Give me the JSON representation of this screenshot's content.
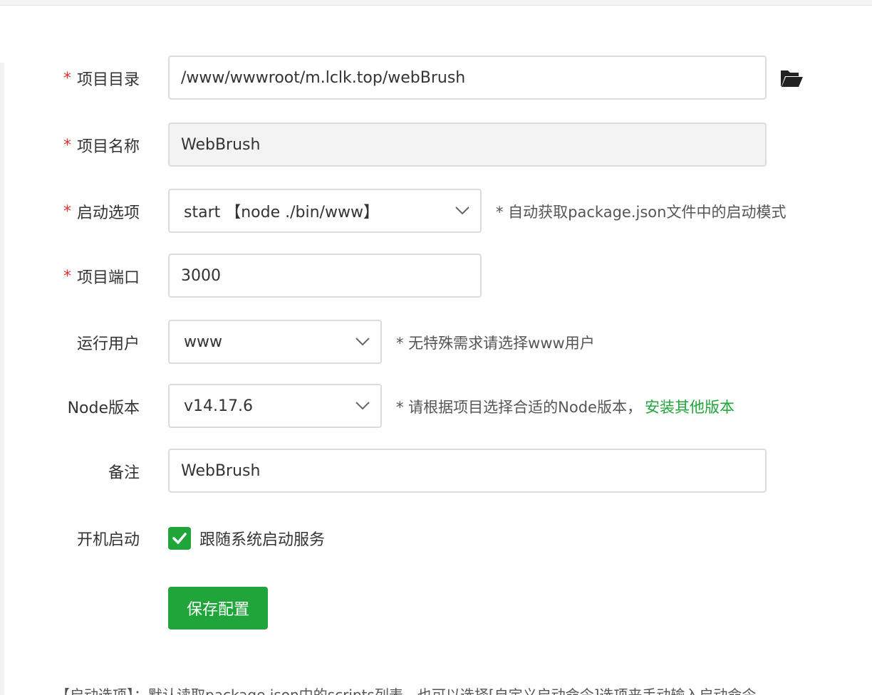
{
  "form": {
    "project_dir": {
      "label": "项目目录",
      "required_mark": "*",
      "value": "/www/wwwroot/m.lclk.top/webBrush"
    },
    "project_name": {
      "label": "项目名称",
      "required_mark": "*",
      "value": "WebBrush"
    },
    "start_option": {
      "label": "启动选项",
      "required_mark": "*",
      "selected": "start 【node ./bin/www】",
      "hint": "* 自动获取package.json文件中的启动模式"
    },
    "project_port": {
      "label": "项目端口",
      "required_mark": "*",
      "value": "3000"
    },
    "run_user": {
      "label": "运行用户",
      "selected": "www",
      "hint": "* 无特殊需求请选择www用户"
    },
    "node_version": {
      "label": "Node版本",
      "selected": "v14.17.6",
      "hint": "* 请根据项目选择合适的Node版本，",
      "install_link": "安装其他版本"
    },
    "remark": {
      "label": "备注",
      "value": "WebBrush"
    },
    "autostart": {
      "label": "开机启动",
      "checkbox_label": "跟随系统启动服务",
      "checked": true
    }
  },
  "save_button": "保存配置",
  "footnote": "【启动选项】：默认读取package.json中的scripts列表，也可以选择[自定义启动命令]选项来手动输入启动命令",
  "colors": {
    "accent": "#20a53a",
    "required": "#e0312e"
  },
  "icons": {
    "folder": "folder-open-icon",
    "chevron": "chevron-down-icon",
    "check": "check-icon"
  }
}
